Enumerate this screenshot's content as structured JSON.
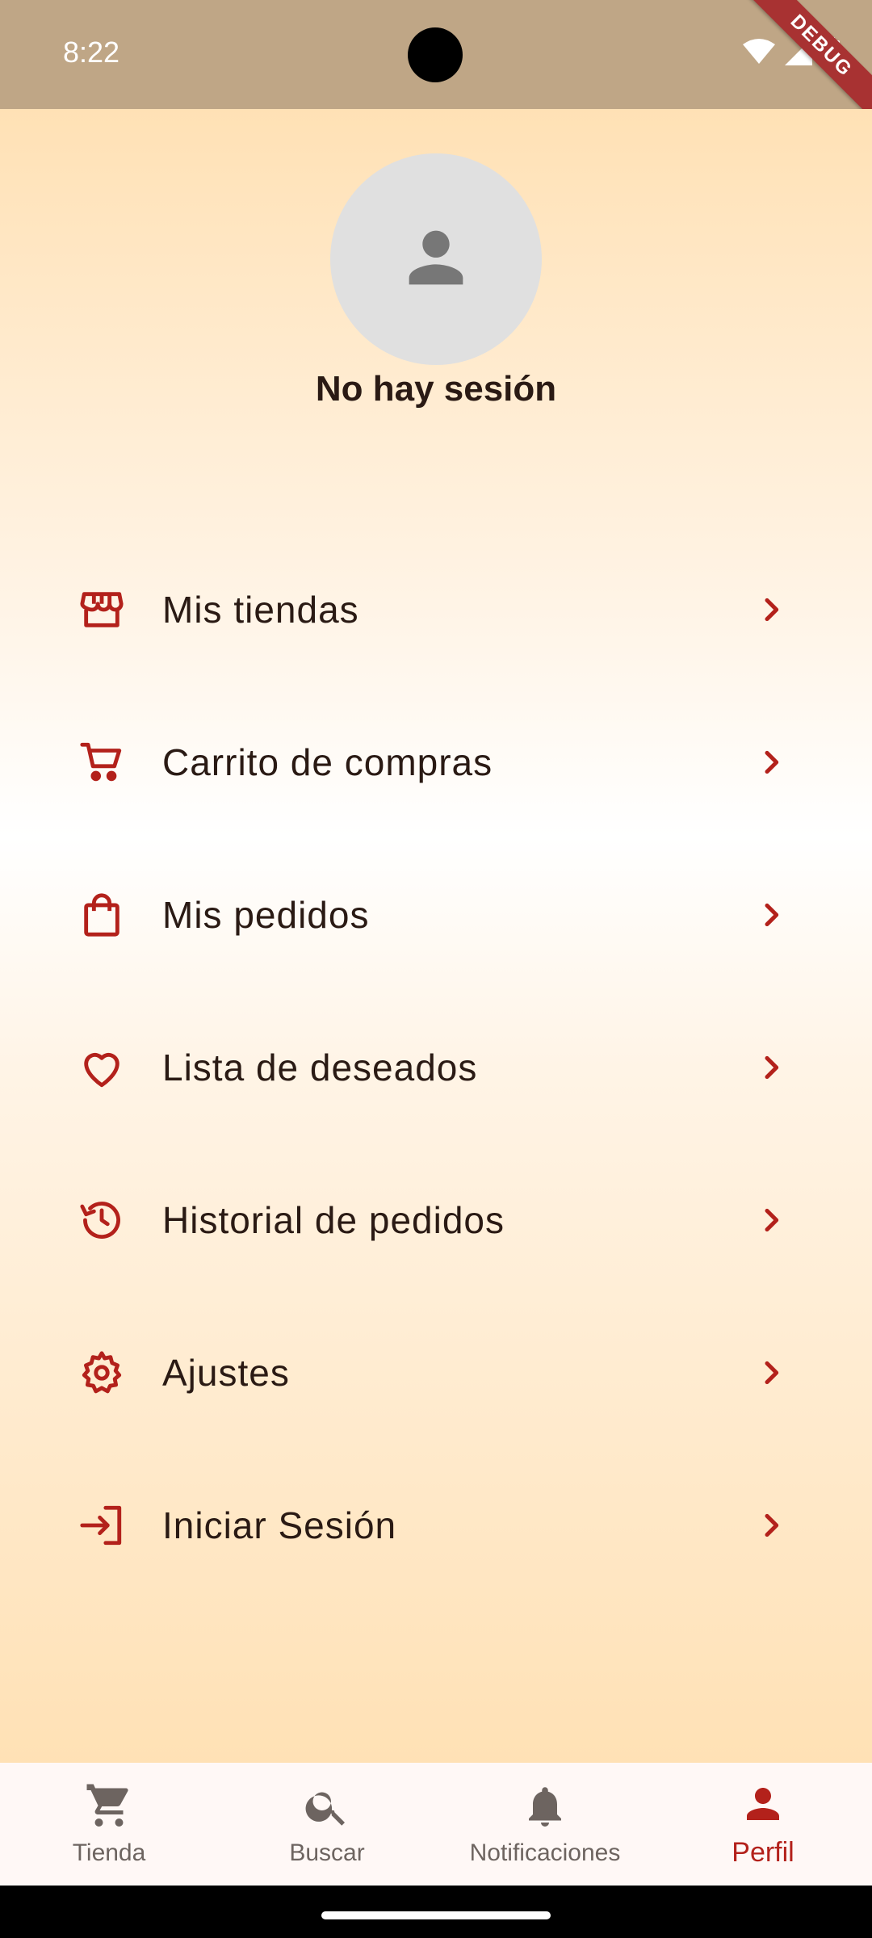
{
  "status_bar": {
    "time": "8:22",
    "icons": [
      "wifi-icon",
      "signal-icon",
      "battery-icon"
    ],
    "debug_label": "DEBUG"
  },
  "profile": {
    "avatar_icon": "person-icon",
    "title": "No hay sesión"
  },
  "menu": {
    "items": [
      {
        "label": "Mis tiendas",
        "icon": "store-icon"
      },
      {
        "label": "Carrito de compras",
        "icon": "cart-icon"
      },
      {
        "label": "Mis pedidos",
        "icon": "shopping-bag-icon"
      },
      {
        "label": "Lista de deseados",
        "icon": "heart-icon"
      },
      {
        "label": "Historial de pedidos",
        "icon": "history-icon"
      },
      {
        "label": "Ajustes",
        "icon": "gear-icon"
      },
      {
        "label": "Iniciar Sesión",
        "icon": "login-icon"
      }
    ]
  },
  "bottom_nav": {
    "items": [
      {
        "label": "Tienda",
        "icon": "cart-icon",
        "active": false
      },
      {
        "label": "Buscar",
        "icon": "search-icon",
        "active": false
      },
      {
        "label": "Notificaciones",
        "icon": "bell-icon",
        "active": false
      },
      {
        "label": "Perfil",
        "icon": "person-icon",
        "active": true
      }
    ]
  },
  "colors": {
    "accent": "#b3211b",
    "status_bar": "#bfa686",
    "inactive": "#6d6460",
    "text": "#2a1a14"
  }
}
